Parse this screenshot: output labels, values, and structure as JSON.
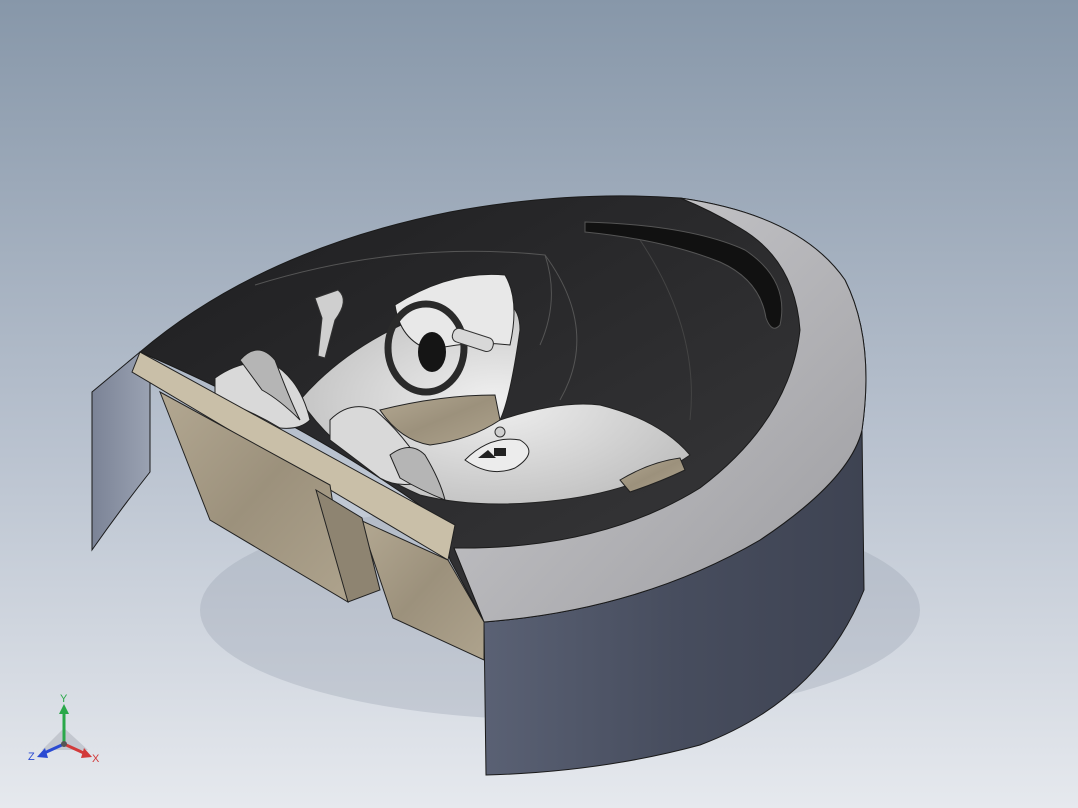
{
  "triad": {
    "x_label": "X",
    "y_label": "Y",
    "z_label": "Z"
  },
  "colors": {
    "background_top": "#8a9aab",
    "background_bottom": "#e4e8ee",
    "shell_side": "#4e5567",
    "shell_rim": "#b4b4b8",
    "interior": "#2a2a2c",
    "wood": "#a69b86",
    "axis_x": "#d23a3a",
    "axis_y": "#2aa84a",
    "axis_z": "#2a4ad2"
  }
}
